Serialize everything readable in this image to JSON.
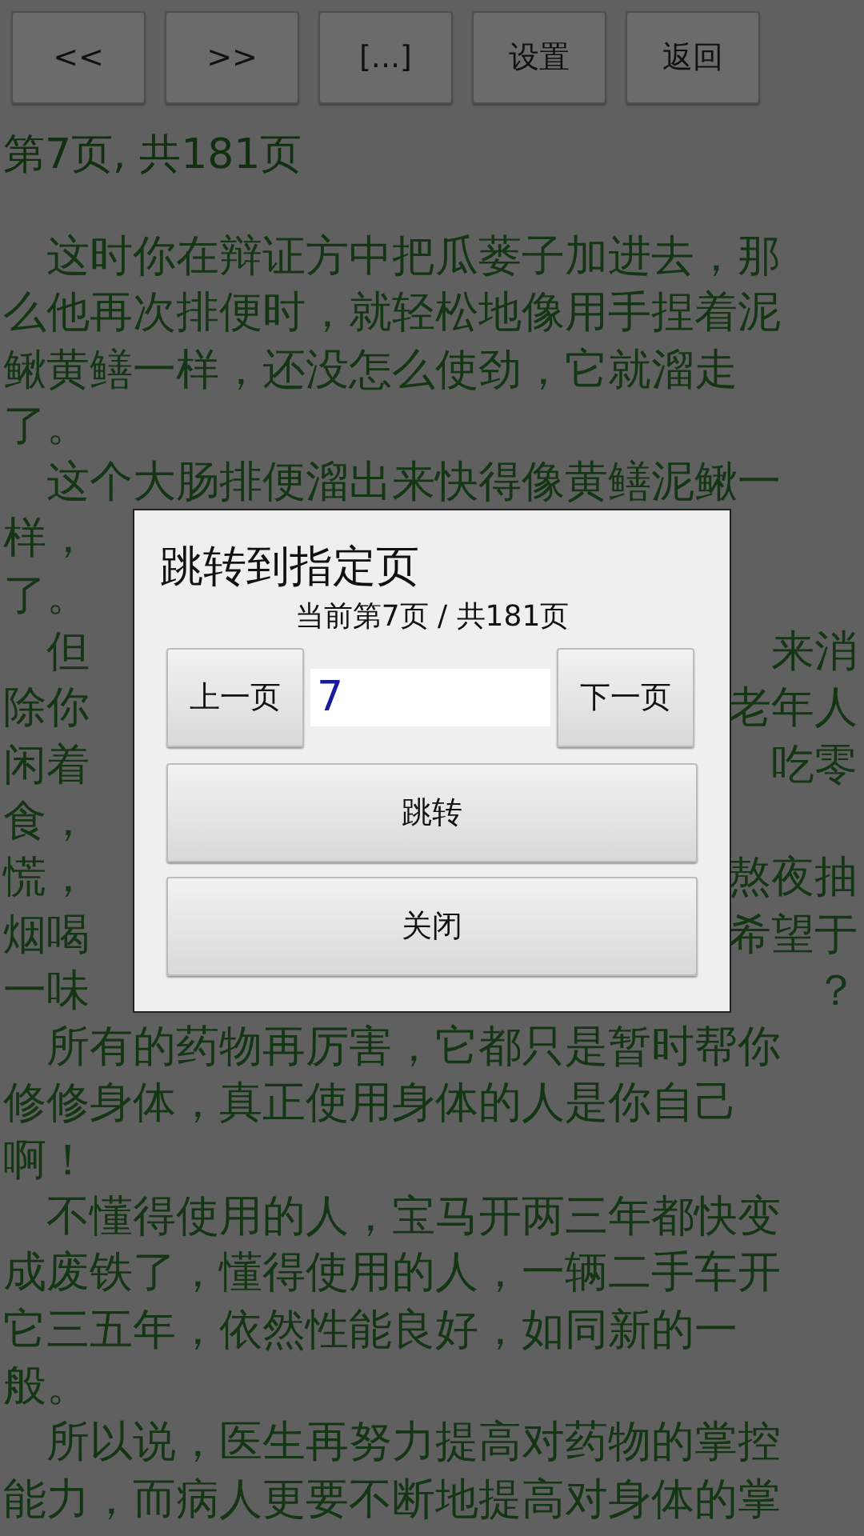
{
  "toolbar": {
    "buttons": [
      "<<",
      ">>",
      "[...]",
      "设置",
      "返回"
    ]
  },
  "page_indicator": "第7页, 共181页",
  "text_lines": [
    {
      "indent": true,
      "text": "这时你在辩证方中把瓜蒌子加进去，那"
    },
    {
      "indent": false,
      "text": "么他再次排便时，就轻松地像用手捏着泥"
    },
    {
      "indent": false,
      "text": "鳅黄鳝一样，还没怎么使劲，它就溜走"
    },
    {
      "indent": false,
      "text": "了。"
    },
    {
      "indent": true,
      "text": "这个大肠排便溜出来快得像黄鳝泥鳅一"
    },
    {
      "indent": false,
      "left": "样，"
    },
    {
      "indent": false,
      "left": "了。"
    },
    {
      "indent": true,
      "left": "但",
      "right": "来消"
    },
    {
      "indent": false,
      "left": "除你",
      "right": "老年人"
    },
    {
      "indent": false,
      "left": "闲着",
      "right": "吃零"
    },
    {
      "indent": false,
      "left": "食，"
    },
    {
      "indent": false,
      "left": "慌，",
      "right": "熬夜抽"
    },
    {
      "indent": false,
      "left": "烟喝",
      "right": "希望于"
    },
    {
      "indent": false,
      "left": "一味",
      "right": "？"
    },
    {
      "indent": true,
      "text": "所有的药物再厉害，它都只是暂时帮你"
    },
    {
      "indent": false,
      "text": "修修身体，真正使用身体的人是你自己"
    },
    {
      "indent": false,
      "text": "啊！"
    },
    {
      "indent": true,
      "text": "不懂得使用的人，宝马开两三年都快变"
    },
    {
      "indent": false,
      "text": "成废铁了，懂得使用的人，一辆二手车开"
    },
    {
      "indent": false,
      "text": "它三五年，依然性能良好，如同新的一"
    },
    {
      "indent": false,
      "text": "般。"
    },
    {
      "indent": true,
      "text": "所以说，医生再努力提高对药物的掌控"
    },
    {
      "indent": false,
      "text": "能力，而病人更要不断地提高对身体的掌"
    }
  ],
  "dialog": {
    "title": "跳转到指定页",
    "status": "当前第7页 / 共181页",
    "prev_button": "上一页",
    "input": {
      "value": "7"
    },
    "next_button": "下一页",
    "jump_button": "跳转",
    "close_button": "关闭"
  }
}
